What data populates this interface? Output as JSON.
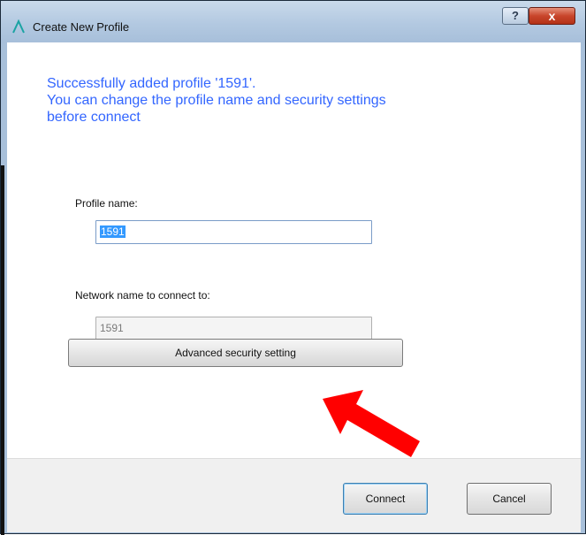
{
  "window": {
    "title": "Create New Profile",
    "icon": "lambda-logo-icon",
    "help_label": "?",
    "close_label": "x"
  },
  "message": {
    "line1": "Successfully added profile '1591'.",
    "line2": "You can change the profile name and security settings",
    "line3": "before connect"
  },
  "profile_name": {
    "label": "Profile name:",
    "value": "1591"
  },
  "network_name": {
    "label": "Network name to connect to:",
    "value": "1591"
  },
  "advanced_button": {
    "label": "Advanced security setting"
  },
  "footer": {
    "connect_label": "Connect",
    "cancel_label": "Cancel"
  },
  "annotation": {
    "icon": "red-arrow-icon",
    "color": "#ff0000"
  },
  "colors": {
    "message_text": "#3366ff",
    "titlebar": "#b3c9e1"
  }
}
